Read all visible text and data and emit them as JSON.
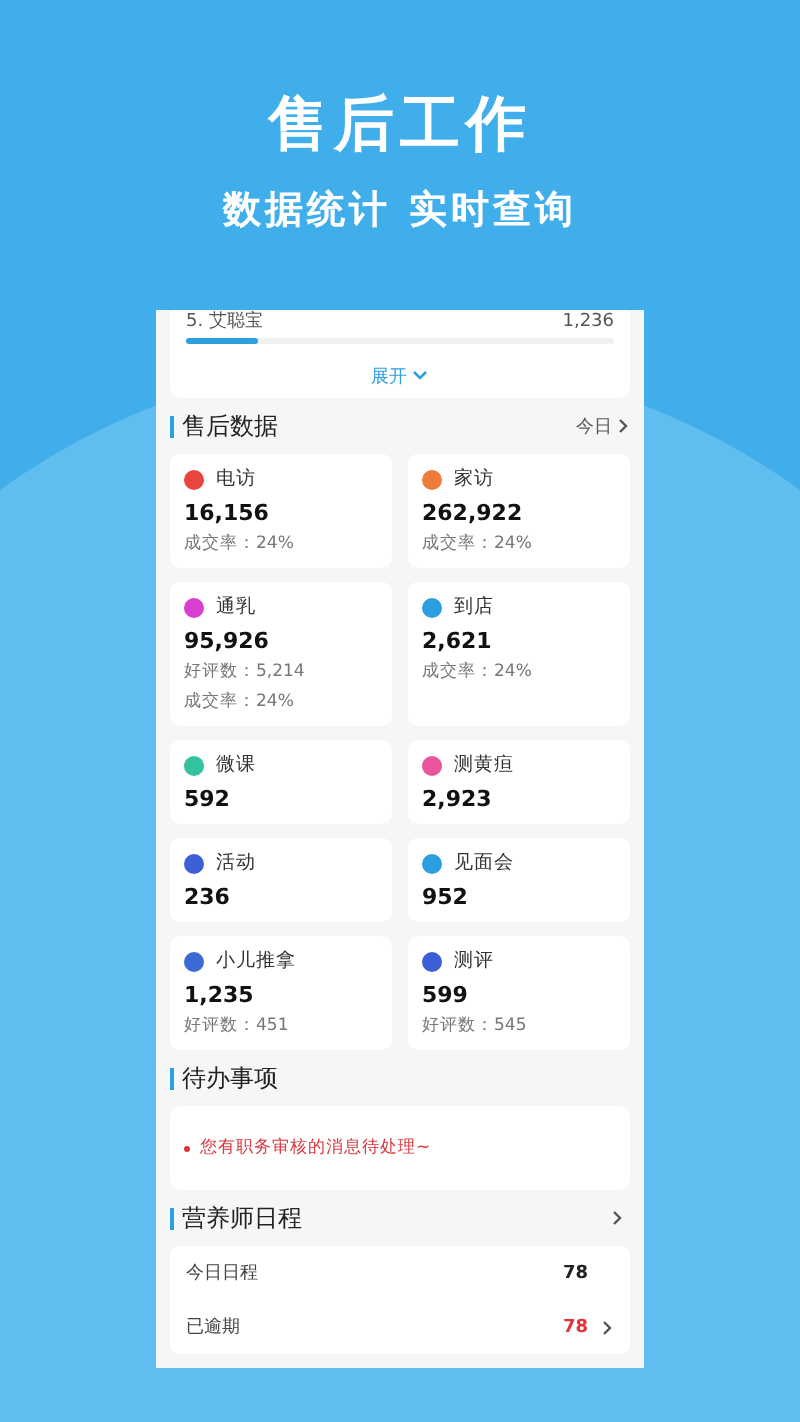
{
  "hero": {
    "title": "售后工作",
    "subtitle": "数据统计 实时查询"
  },
  "ranking_row": {
    "label": "5. 艾聪宝",
    "value": "1,236",
    "level": 0.17
  },
  "expand_link": "展开",
  "after_sales": {
    "title": "售后数据",
    "period": "今日",
    "items": [
      {
        "label": "电访",
        "value": "16,156",
        "color": "#e8453c",
        "notes": [
          "成交率：24%"
        ]
      },
      {
        "label": "家访",
        "value": "262,922",
        "color": "#f07a3a",
        "notes": [
          "成交率：24%"
        ]
      },
      {
        "label": "通乳",
        "value": "95,926",
        "color": "#d63fcf",
        "notes": [
          "好评数：5,214",
          "成交率：24%"
        ]
      },
      {
        "label": "到店",
        "value": "2,621",
        "color": "#2c9fe0",
        "notes": [
          "成交率：24%"
        ]
      },
      {
        "label": "微课",
        "value": "592",
        "color": "#33c2a0"
      },
      {
        "label": "测黄疸",
        "value": "2,923",
        "color": "#e8559a"
      },
      {
        "label": "活动",
        "value": "236",
        "color": "#3c5fd6"
      },
      {
        "label": "见面会",
        "value": "952",
        "color": "#2c9fe0"
      },
      {
        "label": "小儿推拿",
        "value": "1,235",
        "color": "#3c6ad6",
        "notes": [
          "好评数：451"
        ]
      },
      {
        "label": "测评",
        "value": "599",
        "color": "#3c5fd6",
        "notes": [
          "好评数：545"
        ]
      }
    ]
  },
  "todo": {
    "title": "待办事项",
    "items": [
      "您有职务审核的消息待处理~"
    ]
  },
  "schedule": {
    "title": "营养师日程",
    "rows": [
      {
        "label": "今日日程",
        "value": "78",
        "overdue": false
      },
      {
        "label": "已逾期",
        "value": "78",
        "overdue": true
      }
    ]
  }
}
